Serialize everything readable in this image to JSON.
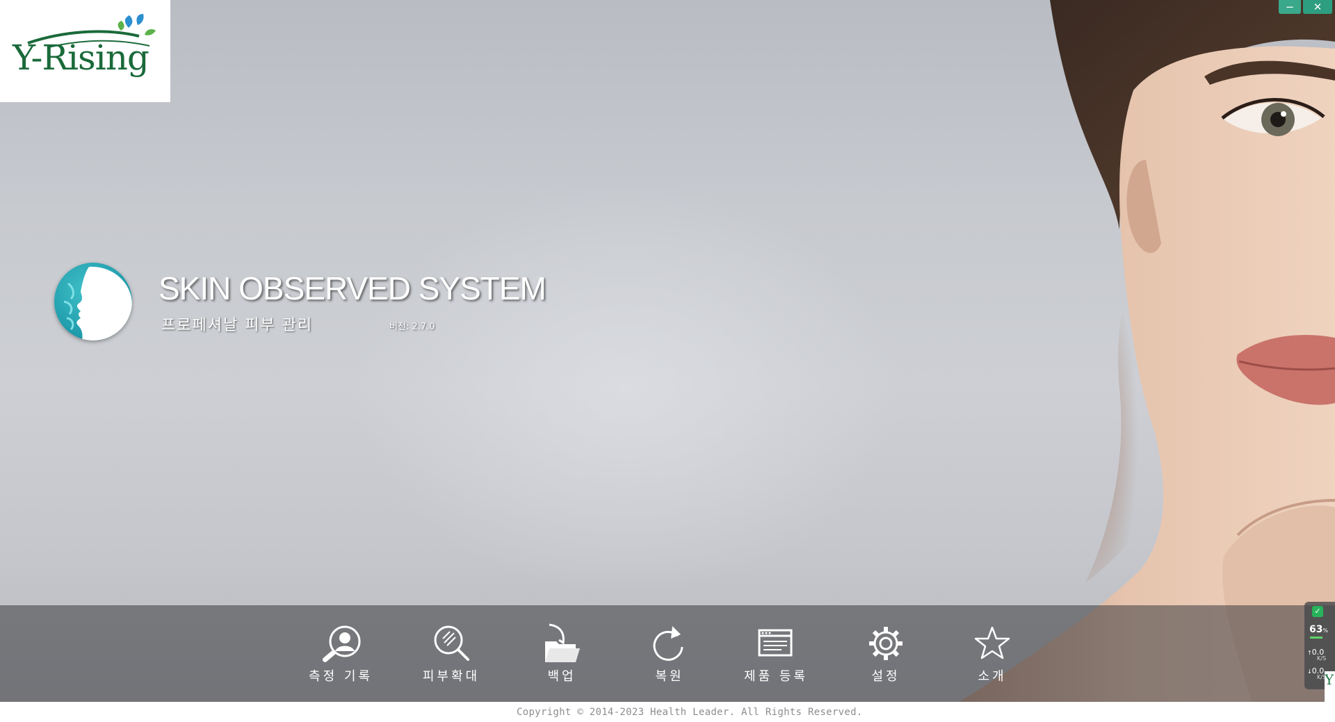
{
  "window": {
    "minimize_symbol": "−",
    "close_symbol": "✕"
  },
  "logo": {
    "text": "Y-Rising",
    "icon": "leaf-sprout-icon",
    "colors": {
      "text": "#1a6a3a",
      "leaf_blue": "#2b8fd0",
      "leaf_green": "#5bb24a"
    }
  },
  "app": {
    "title": "SKIN OBSERVED SYSTEM",
    "subtitle": "프로페셔날 피부 관리",
    "version": "버전: 2.7.0",
    "emblem_icon": "face-profile-icon"
  },
  "toolbar": {
    "items": [
      {
        "id": "record",
        "label": "측정 기록",
        "icon": "person-search-icon"
      },
      {
        "id": "magnify",
        "label": "피부확대",
        "icon": "magnifier-icon"
      },
      {
        "id": "backup",
        "label": "백업",
        "icon": "folder-backup-icon"
      },
      {
        "id": "restore",
        "label": "복원",
        "icon": "refresh-icon"
      },
      {
        "id": "register",
        "label": "제품 등록",
        "icon": "window-form-icon"
      },
      {
        "id": "settings",
        "label": "설정",
        "icon": "gear-icon"
      },
      {
        "id": "about",
        "label": "소개",
        "icon": "star-icon"
      }
    ]
  },
  "footer": {
    "copyright": "Copyright © 2014-2023  Health Leader.  All Rights Reserved."
  },
  "monitor": {
    "percent": "63",
    "percent_unit": "%",
    "usage_fraction": 0.63,
    "upload_value": "0.0",
    "upload_unit": "K/S",
    "download_value": "0.0",
    "download_unit": "K/S",
    "upload_arrow": "↑",
    "download_arrow": "↓",
    "corner_text": "Y",
    "status_icon": "check-shield-icon",
    "colors": {
      "status": "#28b35a"
    }
  }
}
